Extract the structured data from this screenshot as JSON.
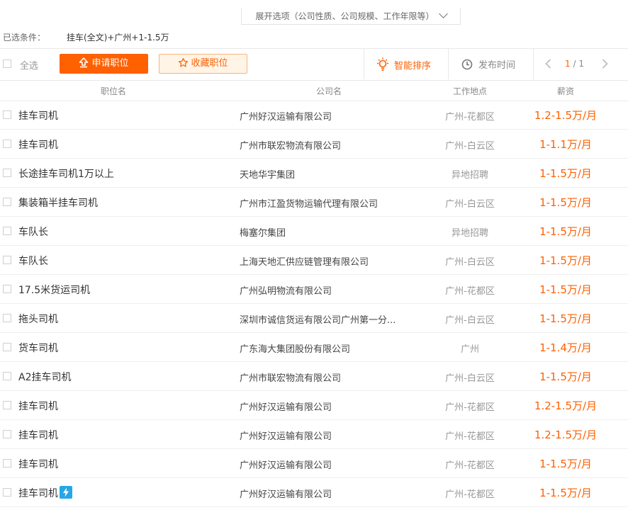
{
  "top": {
    "expand_label": "展开选项（公司性质、公司规模、工作年限等）"
  },
  "filters": {
    "label": "已选条件：",
    "value": "挂车(全文)+广州+1-1.5万"
  },
  "toolbar": {
    "select_all": "全选",
    "apply": "申请职位",
    "favorite": "收藏职位",
    "sort_smart": "智能排序",
    "sort_time": "发布时间",
    "page_current": "1",
    "page_sep": "/",
    "page_total": "1"
  },
  "header": {
    "title": "职位名",
    "company": "公司名",
    "location": "工作地点",
    "salary": "薪资"
  },
  "colors": {
    "accent": "#ff6000",
    "fav_bg": "#fff4e6",
    "bolt": "#27a7e6"
  },
  "jobs": [
    {
      "title": "挂车司机",
      "company": "广州好汉运输有限公司",
      "location": "广州-花都区",
      "salary": "1.2-1.5万/月",
      "badge": false
    },
    {
      "title": "挂车司机",
      "company": "广州市联宏物流有限公司",
      "location": "广州-白云区",
      "salary": "1-1.1万/月",
      "badge": false
    },
    {
      "title": "长途挂车司机1万以上",
      "company": "天地华宇集团",
      "location": "异地招聘",
      "salary": "1-1.5万/月",
      "badge": false
    },
    {
      "title": "集装箱半挂车司机",
      "company": "广州市江盈货物运输代理有限公司",
      "location": "广州-白云区",
      "salary": "1-1.5万/月",
      "badge": false
    },
    {
      "title": "车队长",
      "company": "梅塞尔集团",
      "location": "异地招聘",
      "salary": "1-1.5万/月",
      "badge": false
    },
    {
      "title": "车队长",
      "company": "上海天地汇供应链管理有限公司",
      "location": "广州-白云区",
      "salary": "1-1.5万/月",
      "badge": false
    },
    {
      "title": "17.5米货运司机",
      "company": "广州弘明物流有限公司",
      "location": "广州-花都区",
      "salary": "1-1.5万/月",
      "badge": false
    },
    {
      "title": "拖头司机",
      "company": "深圳市诚信货运有限公司广州第一分...",
      "location": "广州-白云区",
      "salary": "1-1.5万/月",
      "badge": false
    },
    {
      "title": "货车司机",
      "company": "广东海大集团股份有限公司",
      "location": "广州",
      "salary": "1-1.4万/月",
      "badge": false
    },
    {
      "title": "A2挂车司机",
      "company": "广州市联宏物流有限公司",
      "location": "广州-白云区",
      "salary": "1-1.5万/月",
      "badge": false
    },
    {
      "title": "挂车司机",
      "company": "广州好汉运输有限公司",
      "location": "广州-花都区",
      "salary": "1.2-1.5万/月",
      "badge": false
    },
    {
      "title": "挂车司机",
      "company": "广州好汉运输有限公司",
      "location": "广州-花都区",
      "salary": "1.2-1.5万/月",
      "badge": false
    },
    {
      "title": "挂车司机",
      "company": "广州好汉运输有限公司",
      "location": "广州-花都区",
      "salary": "1-1.5万/月",
      "badge": false
    },
    {
      "title": "挂车司机",
      "company": "广州好汉运输有限公司",
      "location": "广州-花都区",
      "salary": "1-1.5万/月",
      "badge": true,
      "badge_icon": "lightning-icon"
    }
  ]
}
